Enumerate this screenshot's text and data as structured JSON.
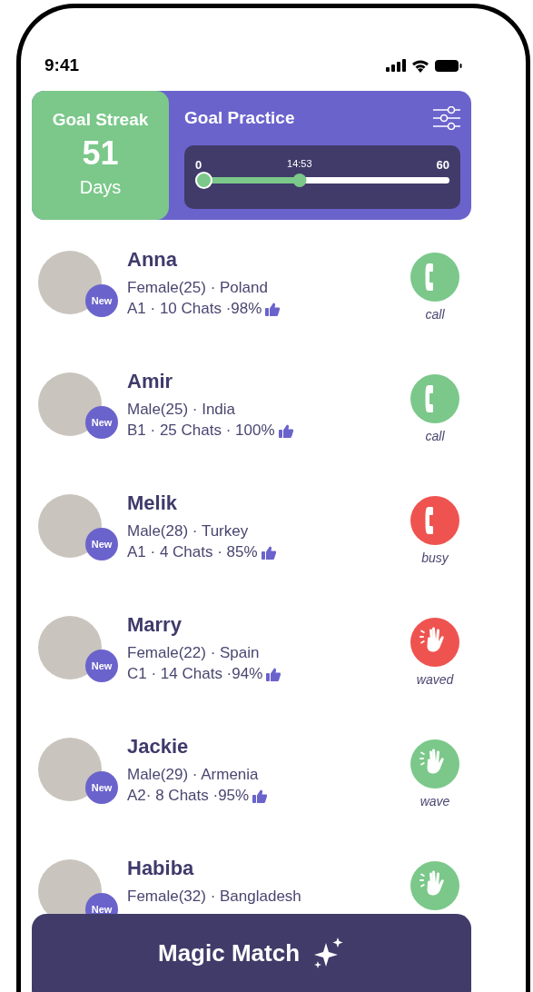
{
  "status_bar": {
    "time": "9:41"
  },
  "goal_streak": {
    "title": "Goal Streak",
    "count": "51",
    "unit": "Days"
  },
  "goal_practice": {
    "title": "Goal Practice",
    "min": "0",
    "max": "60",
    "current": "14:53",
    "level": 0.41
  },
  "users": [
    {
      "name": "Anna",
      "info": "Female(25) · Poland",
      "stats": "A1 · 10 Chats ·98%",
      "badge": "New",
      "action": {
        "kind": "phone",
        "label": "call",
        "color": "#7bc88a"
      }
    },
    {
      "name": "Amir",
      "info": "Male(25) · India",
      "stats": "B1 · 25 Chats · 100%",
      "badge": "New",
      "action": {
        "kind": "phone",
        "label": "call",
        "color": "#7bc88a"
      }
    },
    {
      "name": "Melik",
      "info": "Male(28) · Turkey",
      "stats": "A1 · 4 Chats · 85%",
      "badge": "New",
      "action": {
        "kind": "phone",
        "label": "busy",
        "color": "#ef5350"
      }
    },
    {
      "name": "Marry",
      "info": "Female(22) · Spain",
      "stats": "C1 · 14 Chats ·94%",
      "badge": "New",
      "action": {
        "kind": "hand",
        "label": "waved",
        "color": "#ef5350"
      }
    },
    {
      "name": "Jackie",
      "info": "Male(29) · Armenia",
      "stats": "A2· 8 Chats ·95%",
      "badge": "New",
      "action": {
        "kind": "hand",
        "label": "wave",
        "color": "#7bc88a"
      }
    },
    {
      "name": "Habiba",
      "info": "Female(32) · Bangladesh",
      "badge": "New",
      "action": {
        "kind": "hand",
        "color": "#7bc88a"
      }
    }
  ],
  "magic_match_button": {
    "label": "Magic Match"
  }
}
